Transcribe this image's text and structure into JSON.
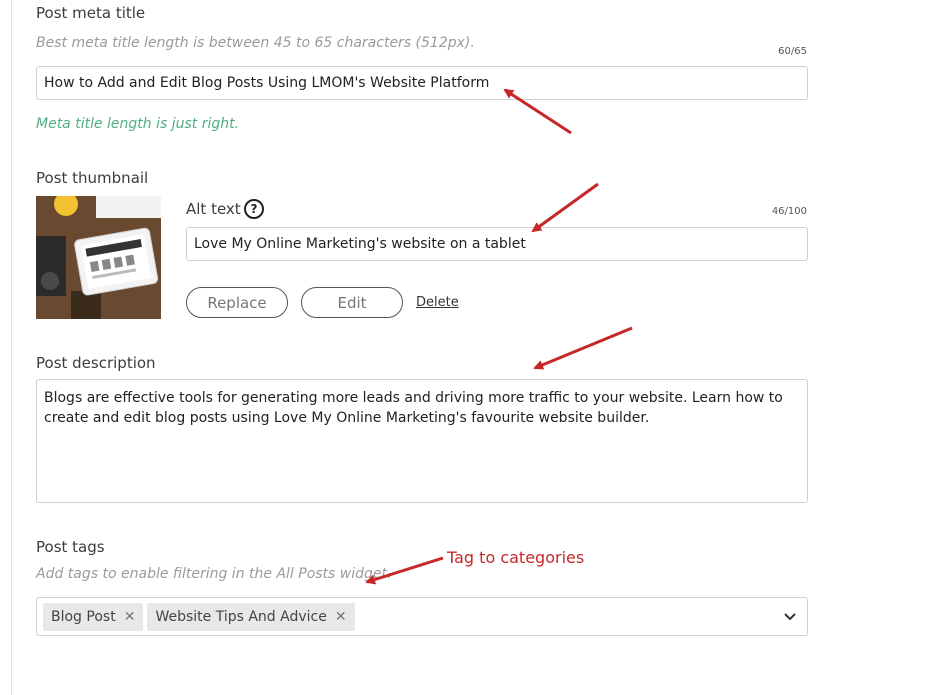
{
  "meta_title": {
    "label": "Post meta title",
    "hint": "Best meta title length is between 45 to 65 characters (512px).",
    "counter": "60/65",
    "value": "How to Add and Edit Blog Posts Using LMOM's Website Platform",
    "status": "Meta title length is just right.",
    "status_color": "#4fae83"
  },
  "thumbnail": {
    "label": "Post thumbnail",
    "alt_label": "Alt text",
    "help_glyph": "?",
    "alt_counter": "46/100",
    "alt_value": "Love My Online Marketing's website on a tablet",
    "replace_label": "Replace",
    "edit_label": "Edit",
    "delete_label": "Delete"
  },
  "description": {
    "label": "Post description",
    "value": "Blogs are effective tools for generating more leads and driving more traffic to your website. Learn how to create and edit blog posts using Love My Online Marketing's favourite website builder."
  },
  "tags": {
    "label": "Post tags",
    "hint": "Add tags to enable filtering in the All Posts widget.",
    "items": [
      {
        "label": "Blog Post",
        "remove_glyph": "✕"
      },
      {
        "label": "Website Tips And Advice",
        "remove_glyph": "✕"
      }
    ],
    "annotation": "Tag to categories"
  },
  "icons": {
    "help": "question-circle-icon",
    "remove": "close-icon",
    "dropdown": "chevron-down-icon"
  },
  "colors": {
    "annotation_red": "#c62828",
    "success_green": "#4fae83"
  }
}
